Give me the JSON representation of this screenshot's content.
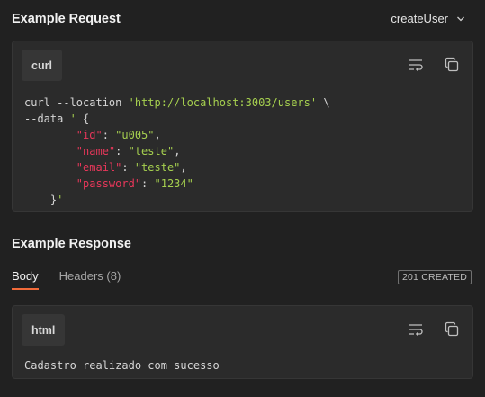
{
  "request": {
    "title": "Example Request",
    "selected_example": "createUser",
    "language": "curl",
    "code_lines": {
      "l1_cmd": "curl --location ",
      "l1_url": "'http://localhost:3003/users'",
      "l1_tail": " \\",
      "l2_cmd": "--data ",
      "l2_q": "'",
      "l2_brace": " {",
      "l3_key": "\"id\"",
      "l3_val": "\"u005\"",
      "l4_key": "\"name\"",
      "l4_val": "\"teste\"",
      "l5_key": "\"email\"",
      "l5_val": "\"teste\"",
      "l6_key": "\"password\"",
      "l6_val": "\"1234\"",
      "l7_brace": "}",
      "l7_q": "'"
    }
  },
  "response": {
    "title": "Example Response",
    "tabs": [
      "Body",
      "Headers (8)"
    ],
    "status": "201 CREATED",
    "language": "html",
    "body": "Cadastro realizado com sucesso"
  },
  "icons": {
    "wrap": "wrap-lines-icon",
    "copy": "copy-icon",
    "dropdown": "chevron-down-icon"
  }
}
